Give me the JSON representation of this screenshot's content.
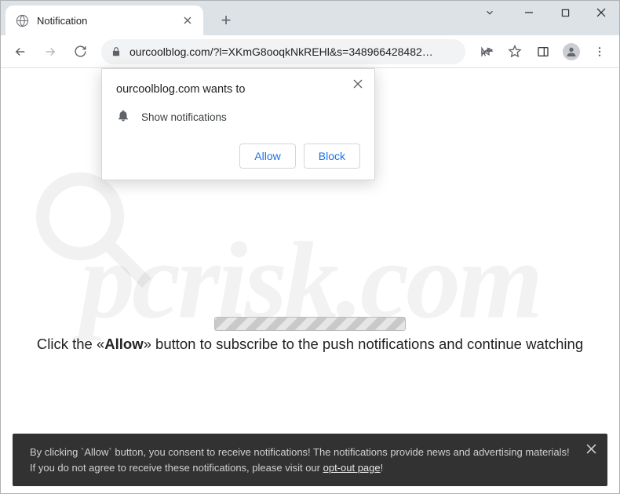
{
  "tab": {
    "title": "Notification"
  },
  "url": "ourcoolblog.com/?l=XKmG8ooqkNkREHl&s=348966428482…",
  "popup": {
    "title": "ourcoolblog.com wants to",
    "permission": "Show notifications",
    "allow": "Allow",
    "block": "Block"
  },
  "instruction": {
    "prefix": "Click the ",
    "em_open": "«",
    "em_word": "Allow",
    "em_close": "»",
    "suffix": " button to subscribe to the push notifications and continue watching"
  },
  "banner": {
    "text1": "By clicking `Allow` button, you consent to receive notifications! The notifications provide news and advertising materials! If you do not agree to receive these notifications, please visit our ",
    "link": "opt-out page",
    "text2": "!"
  },
  "watermark": "pcrisk.com"
}
